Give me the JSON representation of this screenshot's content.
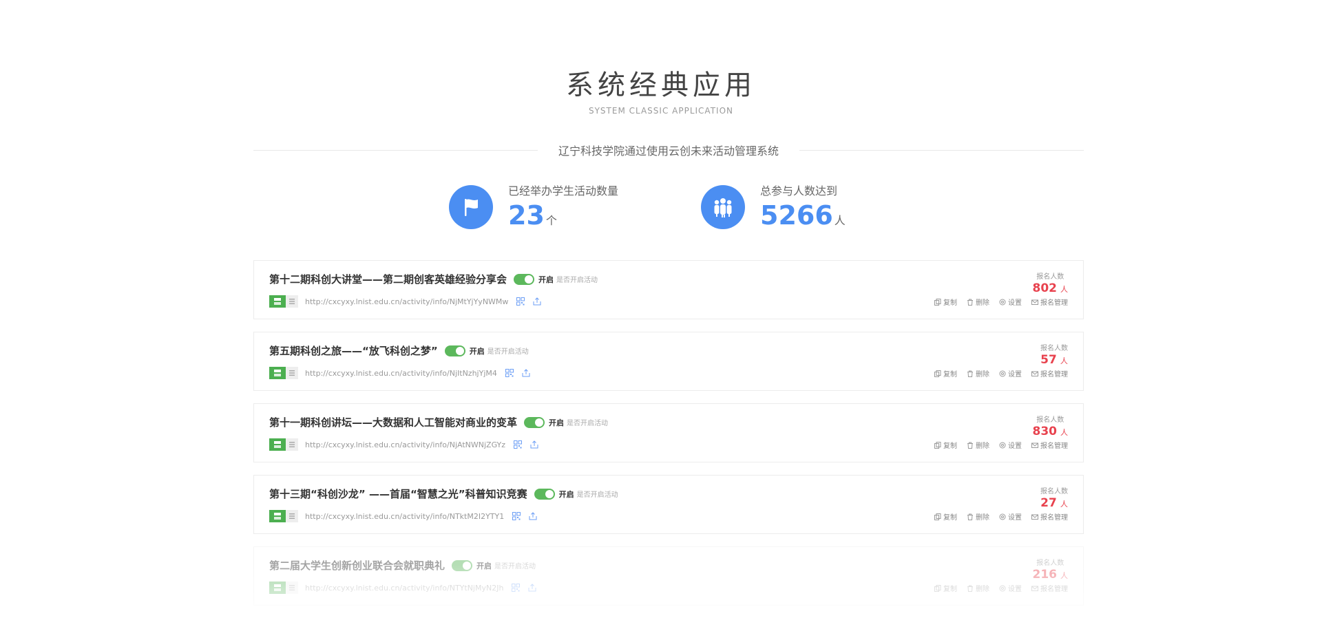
{
  "header": {
    "title": "系统经典应用",
    "subtitle": "SYSTEM CLASSIC APPLICATION",
    "tagline": "辽宁科技学院通过使用云创未来活动管理系统"
  },
  "stats": [
    {
      "icon": "flag-icon",
      "label": "已经举办学生活动数量",
      "value": "23",
      "unit": "个"
    },
    {
      "icon": "people-icon",
      "label": "总参与人数达到",
      "value": "5266",
      "unit": "人"
    }
  ],
  "colors": {
    "accent": "#4b8ef2",
    "toggle": "#5cb85c",
    "count": "#e8424e",
    "qr": "#4caf50"
  },
  "labels": {
    "toggle_on": "开启",
    "toggle_hint": "是否开启活动",
    "count_label": "报名人数",
    "count_unit": "人",
    "copy": "复制",
    "delete": "删除",
    "settings": "设置",
    "manage": "报名管理"
  },
  "activities": [
    {
      "title": "第十二期科创大讲堂——第二期创客英雄经验分享会",
      "url": "http://cxcyxy.lnist.edu.cn/activity/info/NjMtYjYyNWMw",
      "count": "802"
    },
    {
      "title": "第五期科创之旅——“放飞科创之梦”",
      "url": "http://cxcyxy.lnist.edu.cn/activity/info/NjItNzhjYjM4",
      "count": "57"
    },
    {
      "title": "第十一期科创讲坛——大数据和人工智能对商业的变革",
      "url": "http://cxcyxy.lnist.edu.cn/activity/info/NjAtNWNjZGYz",
      "count": "830"
    },
    {
      "title": "第十三期“科创沙龙” ——首届“智慧之光”科普知识竞赛",
      "url": "http://cxcyxy.lnist.edu.cn/activity/info/NTktM2I2YTY1",
      "count": "27"
    },
    {
      "title": "第二届大学生创新创业联合会就职典礼",
      "url": "http://cxcyxy.lnist.edu.cn/activity/info/NTYtNjMyN2Jh",
      "count": "216"
    }
  ]
}
